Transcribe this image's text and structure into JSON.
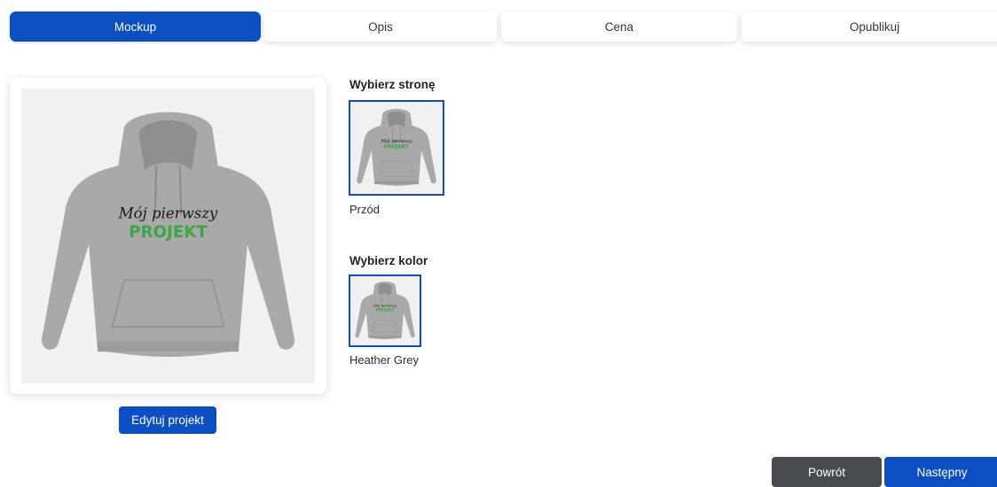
{
  "tabs": [
    {
      "label": "Mockup",
      "active": true
    },
    {
      "label": "Opis",
      "active": false
    },
    {
      "label": "Cena",
      "active": false
    },
    {
      "label": "Opublikuj",
      "active": false
    }
  ],
  "preview": {
    "design_text_line1": "Mój pierwszy",
    "design_text_line2": "PROJEKT",
    "edit_button": "Edytuj projekt"
  },
  "side_picker": {
    "title": "Wybierz stronę",
    "options": [
      {
        "label": "Przód",
        "selected": true
      }
    ]
  },
  "color_picker": {
    "title": "Wybierz kolor",
    "options": [
      {
        "label": "Heather Grey",
        "selected": true
      }
    ]
  },
  "footer": {
    "back_button": "Powrót",
    "next_button": "Następny"
  },
  "colors": {
    "accent": "#0b4fc3",
    "back_button": "#474a4e",
    "garment": "#a9a9a9",
    "design_text": "#1a1a1a",
    "design_accent": "#3aa648",
    "preview_bg": "#f1f1f1"
  },
  "icons": {
    "product": "hoodie-image"
  }
}
